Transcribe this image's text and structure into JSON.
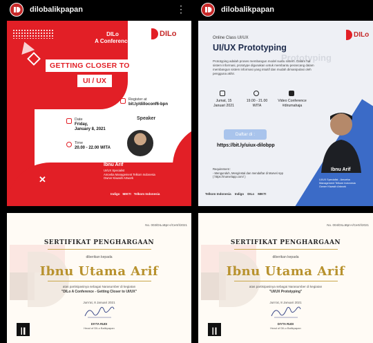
{
  "profile": {
    "username": "dilobalikpapan"
  },
  "post1": {
    "brand": "DILo",
    "conference": "DILo\nA Conference",
    "title_line1": "GETTING CLOSER TO",
    "title_line2": "UI / UX",
    "date_label": "Date",
    "date_value": "Friday,\nJanuary 8, 2021",
    "register_label": "Register at",
    "register_value": "bit.ly/dilloconf6-bpn",
    "time_label": "Time",
    "time_value": "20.00 - 22.00 WITA",
    "speaker_label": "Speaker",
    "speaker_name": "Ibnu Arif",
    "speaker_desc": "UI/UX Specialist\nAmoeba Management Telkom Indonesia\nOwner Kiwasih Artwork",
    "sponsors": [
      "Indigo",
      "MIKTI",
      "Telkom Indonesia"
    ]
  },
  "post2": {
    "brand": "DILo",
    "online_class": "Online Class UI/UX",
    "title": "UI/UX Prototyping",
    "ghost": "Prototyping",
    "description": "Prototyping adalah proses membangun model suatu sistem. Dalam hal sistem informasi, prototype digunakan untuk membantu perancang dalam membangun sistem informasi yang intuitif dan mudah dimanipulasi oleh pengguna akhir.",
    "date_value": "Jumat, 15\nJanuari 2021",
    "time_value": "19.00 - 21.00\nWITA",
    "platform_value": "Video Conference\n#dirumahaja",
    "register_button": "Daftar di :",
    "link": "https://bit.ly/uiux-dilobpp",
    "requirements": "Requirement :\n- Mengunduh, Menginstal dan mendaftar di Marvel App\n( https://marvelapp.com/ )",
    "speaker_name": "Ibnu Arif",
    "speaker_desc": "UI/UX Specialist - Amoeba\nManagement Telkom Indonesia\nOwner Kiwasih Artwork",
    "sponsors": [
      "Telkom Indonesia",
      "Indigo",
      "DILo",
      "MIKTI"
    ]
  },
  "cert1": {
    "code": "No. 003/DILoBpn-I/Cert/I/2021",
    "heading": "SERTIFIKAT PENGHARGAAN",
    "given": "diberikan kepada",
    "name": "Ibnu Utama Arif",
    "role": "atas partisipasinya sebagai Narasumber di kegiatan",
    "event": "\"DILo A Conference - Getting Closer to UI/UX\"",
    "date": "Jum'at, 8 Januari 2021",
    "signer": "DIYTA RUDI",
    "signer_role": "Head of DILo Balikpapan"
  },
  "cert2": {
    "code": "No. 004/DILoBpn-I/Cert/I/2021",
    "heading": "SERTIFIKAT PENGHARGAAN",
    "given": "diberikan kepada",
    "name": "Ibnu Utama Arif",
    "role": "atas partisipasinya sebagai Narasumber di kegiatan",
    "event": "\"UI/UX Prototyping\"",
    "date": "Jum'at, 8 Januari 2021",
    "signer": "DIYTA RUDI",
    "signer_role": "Head of DILo Balikpapan"
  },
  "colors": {
    "red": "#e21f26",
    "gold": "#b8922e",
    "blue": "#3b6bc7"
  }
}
